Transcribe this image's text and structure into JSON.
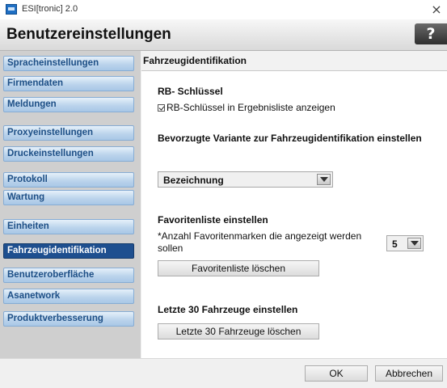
{
  "window": {
    "title": "ESI[tronic] 2.0",
    "close_glyph": "×"
  },
  "header": {
    "title": "Benutzereinstellungen",
    "help_label": "?"
  },
  "sidebar": {
    "items": [
      {
        "label": "Spracheinstellungen"
      },
      {
        "label": "Firmendaten"
      },
      {
        "label": "Meldungen"
      },
      {
        "label": "Proxyeinstellungen"
      },
      {
        "label": "Druckeinstellungen"
      },
      {
        "label": "Protokoll"
      },
      {
        "label": "Wartung"
      },
      {
        "label": "Einheiten"
      },
      {
        "label": "Fahrzeugidentifikation",
        "active": true
      },
      {
        "label": "Benutzeroberfläche"
      },
      {
        "label": "Asanetwork"
      },
      {
        "label": "Produktverbesserung"
      }
    ]
  },
  "main": {
    "section_title": "Fahrzeugidentifikation",
    "rb": {
      "heading": "RB- Schlüssel",
      "checkbox_label": "RB-Schlüssel in Ergebnisliste anzeigen",
      "checked": true
    },
    "variant": {
      "heading": "Bevorzugte Variante zur Fahrzeugidentifikation einstellen",
      "selected": "Bezeichnung"
    },
    "favorites": {
      "heading": "Favoritenliste einstellen",
      "count_label_line1": "*Anzahl Favoritenmarken die angezeigt werden",
      "count_label_line2": "sollen",
      "count_value": "5",
      "clear_button": "Favoritenliste löschen"
    },
    "recent": {
      "heading": "Letzte 30 Fahrzeuge einstellen",
      "clear_button": "Letzte 30 Fahrzeuge löschen"
    }
  },
  "footer": {
    "ok_label": "OK",
    "cancel_label": "Abbrechen"
  },
  "colors": {
    "nav_active_bg": "#1e4f8f",
    "nav_text": "#1d4f86",
    "sidebar_bg": "#cfcfcf"
  }
}
